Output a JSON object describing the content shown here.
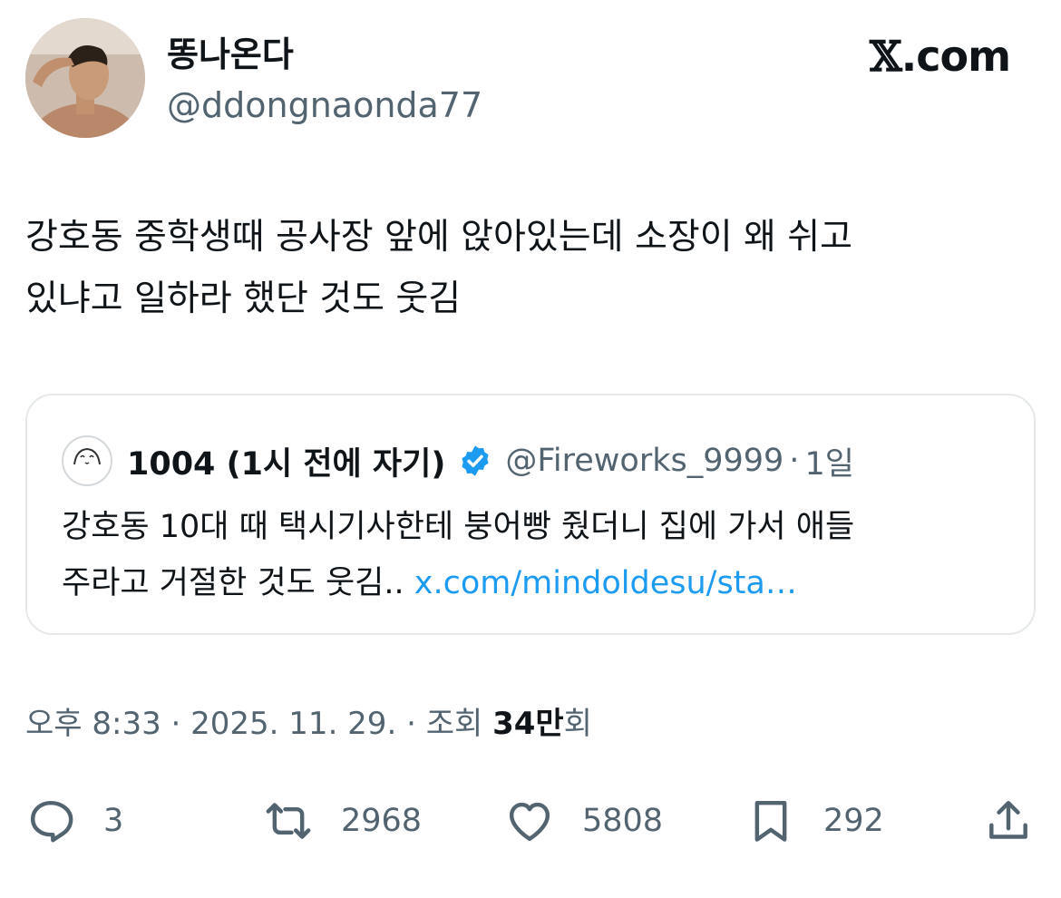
{
  "author": {
    "display_name": "똥나온다",
    "handle": "@ddongnaonda77"
  },
  "site_logo": {
    "mark": "𝕏",
    "suffix": ".com"
  },
  "tweet_text": "강호동 중학생때 공사장 앞에 앉아있는데 소장이 왜 쉬고\n있냐고 일하라 했단 것도 웃김",
  "quoted_tweet": {
    "name": "1004 (1시 전에 자기)",
    "handle": "@Fireworks_9999",
    "separator": "·",
    "time": "1일",
    "verified": true,
    "text": "강호동 10대 때 택시기사한테 붕어빵 줬더니 집에 가서 애들\n주라고 거절한 것도 웃김.. ",
    "link": "x.com/mindoldesu/sta…"
  },
  "meta": {
    "time": "오후 8:33",
    "date": "2025. 11. 29.",
    "sep": "·",
    "views_label": "조회",
    "views_count": "34만",
    "views_suffix": "회"
  },
  "actions": {
    "reply": {
      "icon": "reply-icon",
      "count": "3"
    },
    "retweet": {
      "icon": "retweet-icon",
      "count": "2968"
    },
    "like": {
      "icon": "heart-icon",
      "count": "5808"
    },
    "bookmark": {
      "icon": "bookmark-icon",
      "count": "292"
    },
    "share": {
      "icon": "share-icon"
    }
  },
  "colors": {
    "accent": "#1d9bf0",
    "muted": "#536471",
    "text": "#0f1419",
    "border": "#e6e9eb"
  }
}
